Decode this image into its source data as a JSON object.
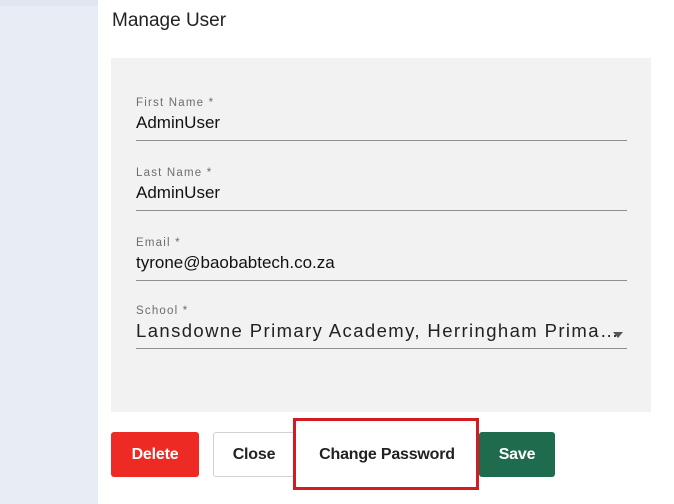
{
  "dialog": {
    "title": "Manage User"
  },
  "form": {
    "first_name": {
      "label": "First Name *",
      "value": "AdminUser"
    },
    "last_name": {
      "label": "Last Name *",
      "value": "AdminUser"
    },
    "email": {
      "label": "Email *",
      "value": "tyrone@baobabtech.co.za"
    },
    "school": {
      "label": "School *",
      "value": "Lansdowne Primary Academy, Herringham Prima…"
    }
  },
  "buttons": {
    "delete": "Delete",
    "close": "Close",
    "change_password": "Change Password",
    "save": "Save"
  },
  "colors": {
    "delete_bg": "#ee2a24",
    "save_bg": "#1e6b4d",
    "highlight": "#d21c22"
  }
}
